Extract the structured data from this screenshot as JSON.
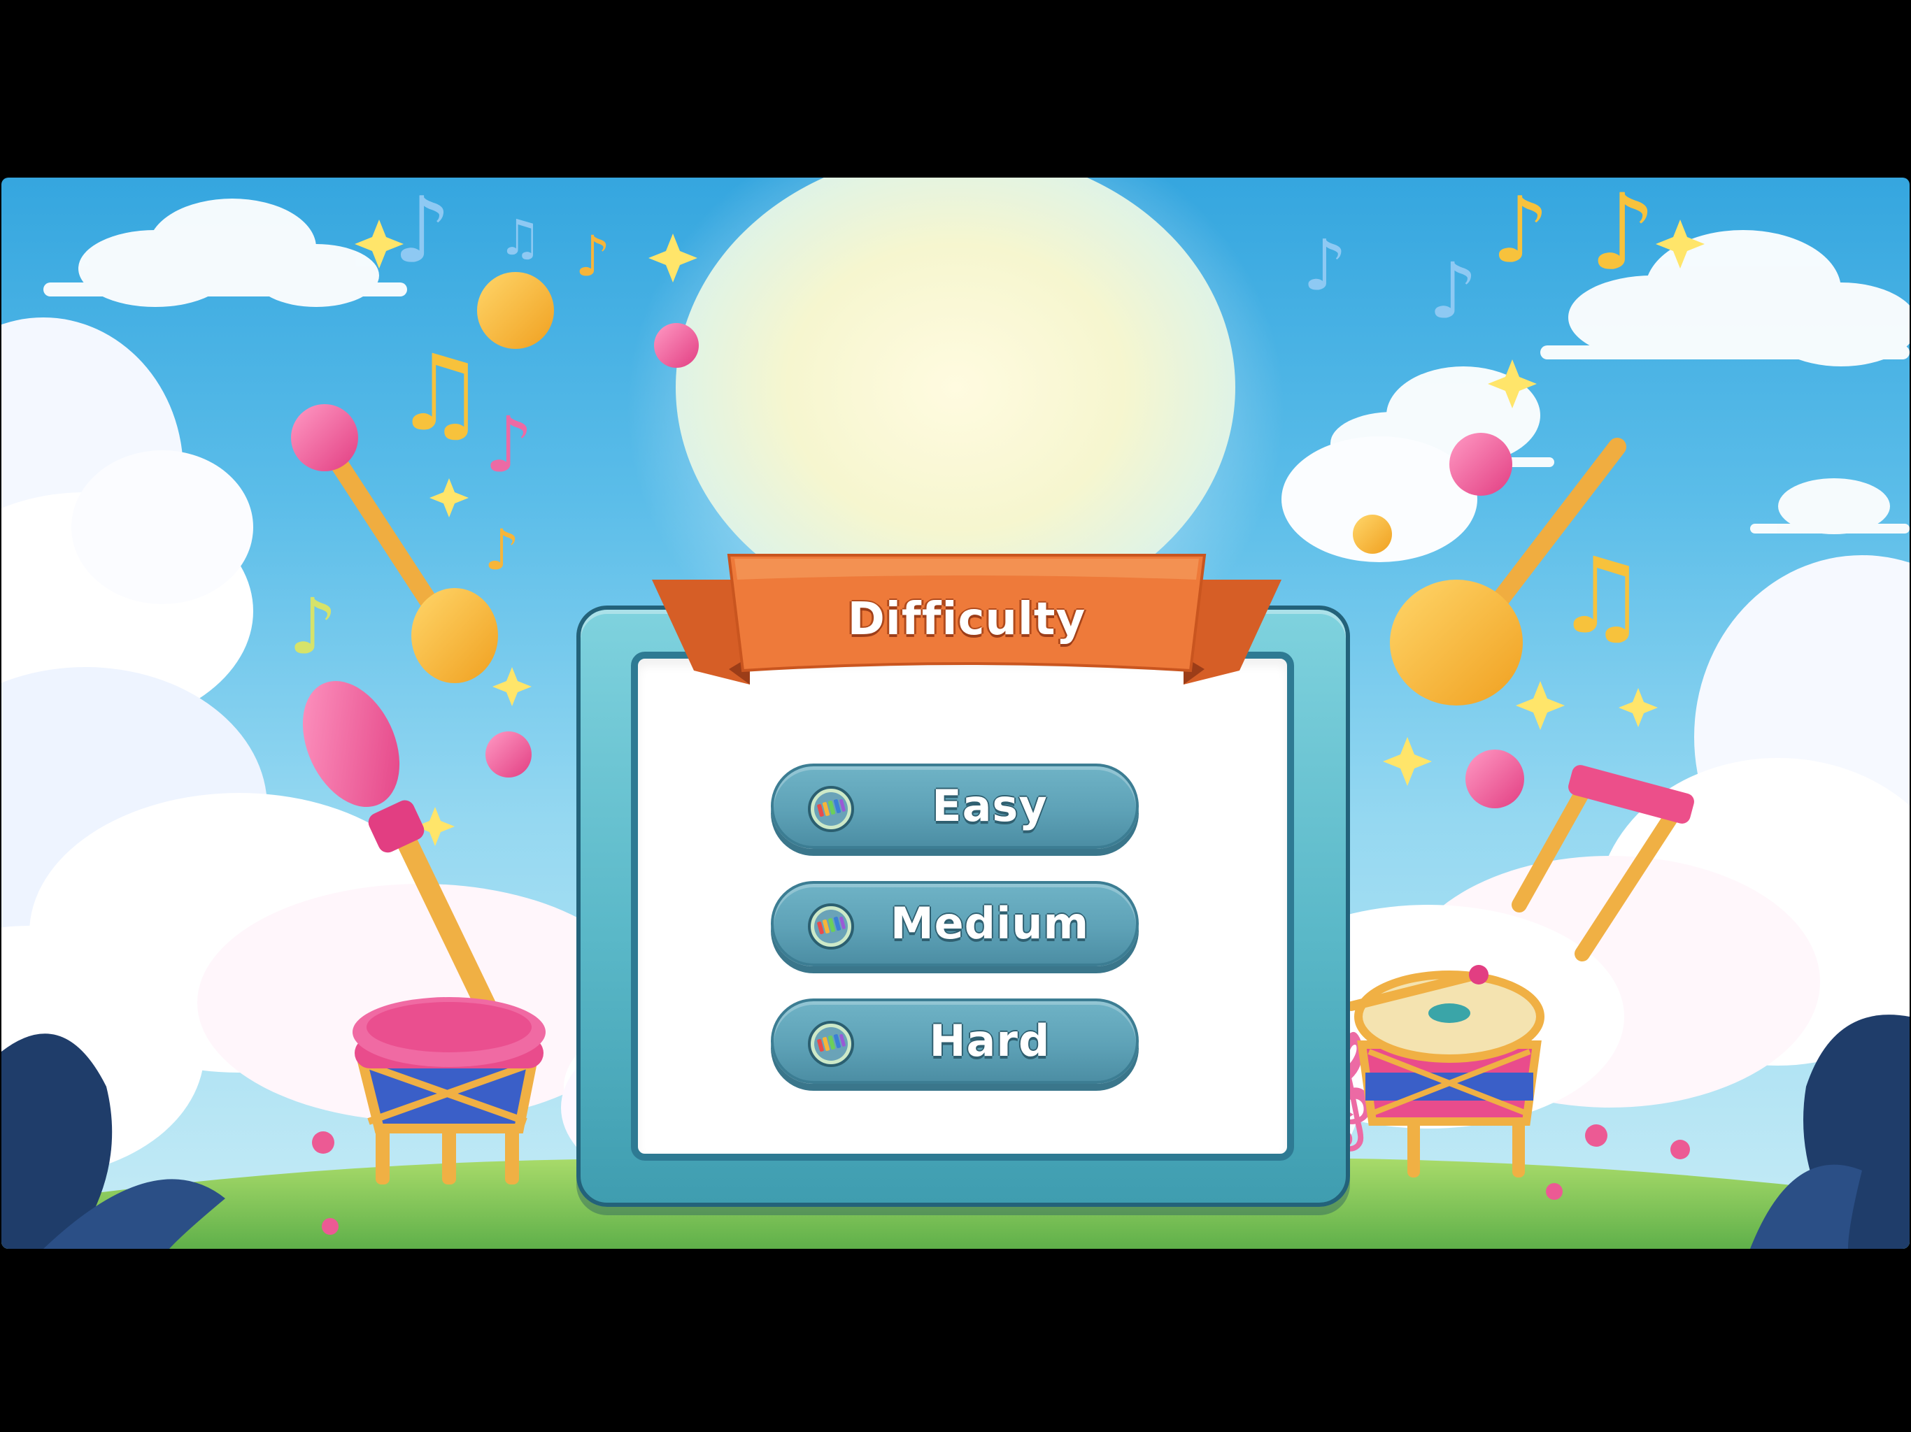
{
  "dialog": {
    "title": "Difficulty"
  },
  "buttons": [
    {
      "label": "Easy",
      "icon": "xylophone-icon"
    },
    {
      "label": "Medium",
      "icon": "xylophone-icon"
    },
    {
      "label": "Hard",
      "icon": "xylophone-icon"
    }
  ],
  "colors": {
    "sky": "#5bbde9",
    "ribbon": "#ec7a3a",
    "frame": "#5ab8c8",
    "button": "#5ea2b7",
    "panel": "#ffffff"
  }
}
